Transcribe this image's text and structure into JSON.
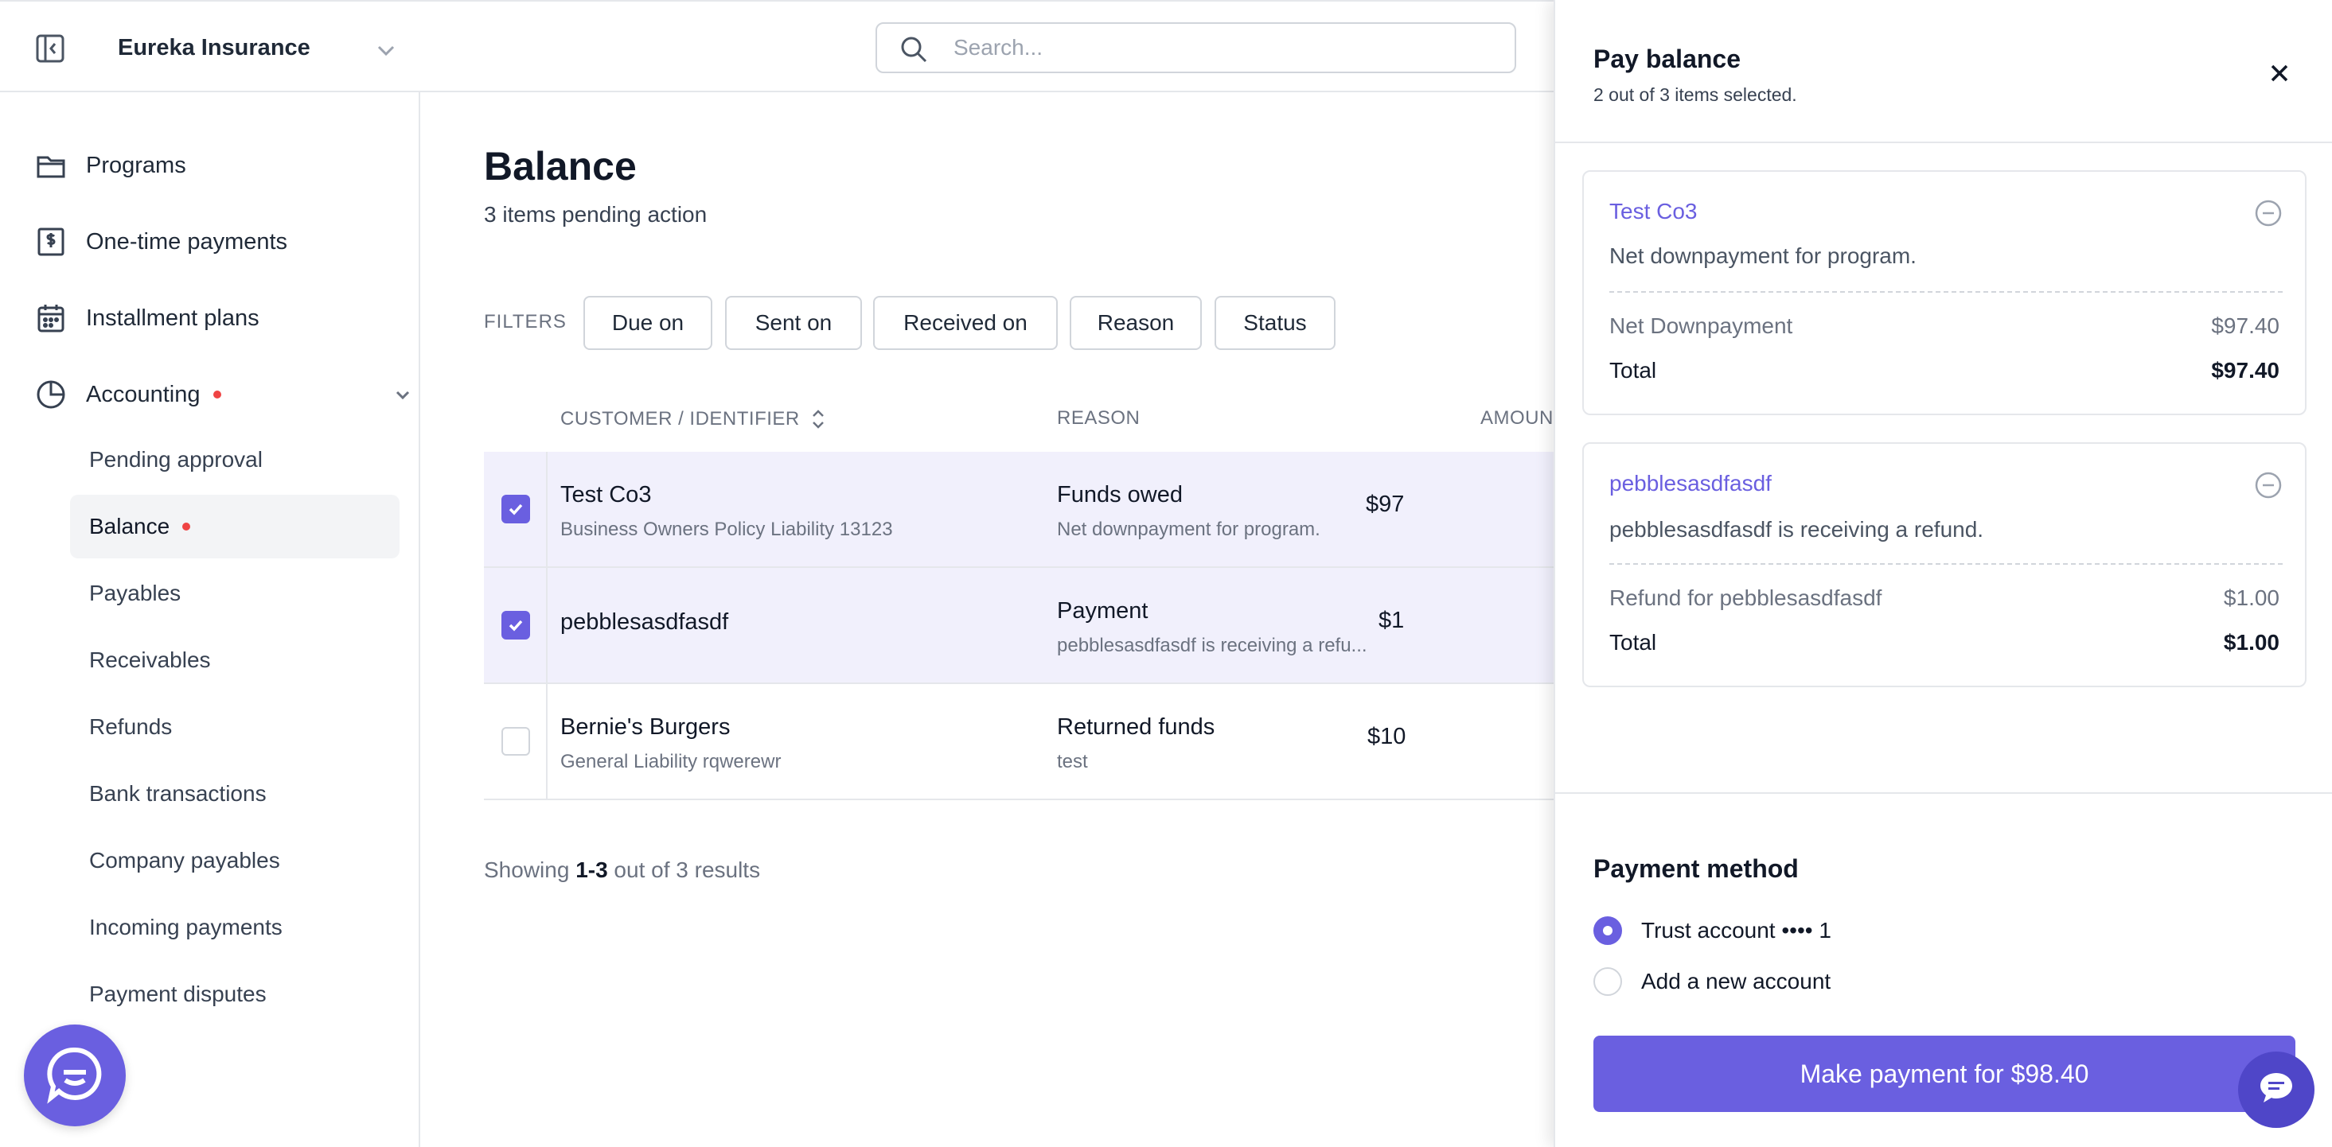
{
  "colors": {
    "accent": "#6a5fe0",
    "selected_row": "#f1f0fc",
    "alert_dot": "#ef4444",
    "border": "#e5e7eb"
  },
  "topbar": {
    "org_name": "Eureka Insurance",
    "search_placeholder": "Search...",
    "icons": [
      "sidebar-collapse-icon",
      "chevron-down-icon",
      "search-icon"
    ]
  },
  "sidebar": {
    "items": [
      {
        "label": "Programs",
        "icon": "folder-icon"
      },
      {
        "label": "One-time payments",
        "icon": "receipt-dollar-icon"
      },
      {
        "label": "Installment plans",
        "icon": "calendar-icon"
      },
      {
        "label": "Accounting",
        "icon": "pie-chart-icon",
        "has_alert": true
      }
    ],
    "accounting_sub": [
      {
        "label": "Pending approval"
      },
      {
        "label": "Balance",
        "active": true,
        "has_alert": true
      },
      {
        "label": "Payables"
      },
      {
        "label": "Receivables"
      },
      {
        "label": "Refunds"
      },
      {
        "label": "Bank transactions"
      },
      {
        "label": "Company payables"
      },
      {
        "label": "Incoming payments"
      },
      {
        "label": "Payment disputes"
      }
    ]
  },
  "main": {
    "title": "Balance",
    "subtitle": "3 items pending action",
    "filters_label": "FILTERS",
    "filters": [
      "Due on",
      "Sent on",
      "Received on",
      "Reason",
      "Status"
    ],
    "columns": [
      "CUSTOMER / IDENTIFIER",
      "REASON",
      "AMOUN"
    ],
    "rows": [
      {
        "checked": true,
        "name": "Test Co3",
        "identifier": "Business Owners Policy Liability 13123",
        "reason": "Funds owed",
        "reason_detail": "Net downpayment for program.",
        "amount": "$97"
      },
      {
        "checked": true,
        "name": "pebblesasdfasdf",
        "identifier": "",
        "reason": "Payment",
        "reason_detail": "pebblesasdfasdf is receiving a refu...",
        "amount": "$1"
      },
      {
        "checked": false,
        "name": "Bernie's Burgers",
        "identifier": "General Liability rqwerewr",
        "reason": "Returned funds",
        "reason_detail": "test",
        "amount": "$10"
      }
    ],
    "results_prefix": "Showing ",
    "results_range": "1-3",
    "results_suffix": " out of 3 results"
  },
  "drawer": {
    "title": "Pay balance",
    "subtitle": "2 out of 3 items selected.",
    "items": [
      {
        "name": "Test Co3",
        "description": "Net downpayment for program.",
        "line_label": "Net Downpayment",
        "line_value": "$97.40",
        "total_label": "Total",
        "total_value": "$97.40"
      },
      {
        "name": "pebblesasdfasdf",
        "description": "pebblesasdfasdf is receiving a refund.",
        "line_label": "Refund for pebblesasdfasdf",
        "line_value": "$1.00",
        "total_label": "Total",
        "total_value": "$1.00"
      }
    ],
    "payment_method_title": "Payment method",
    "payment_options": [
      {
        "label": "Trust account •••• 1",
        "selected": true
      },
      {
        "label": "Add a new account",
        "selected": false
      }
    ],
    "pay_button": "Make payment for $98.40"
  }
}
